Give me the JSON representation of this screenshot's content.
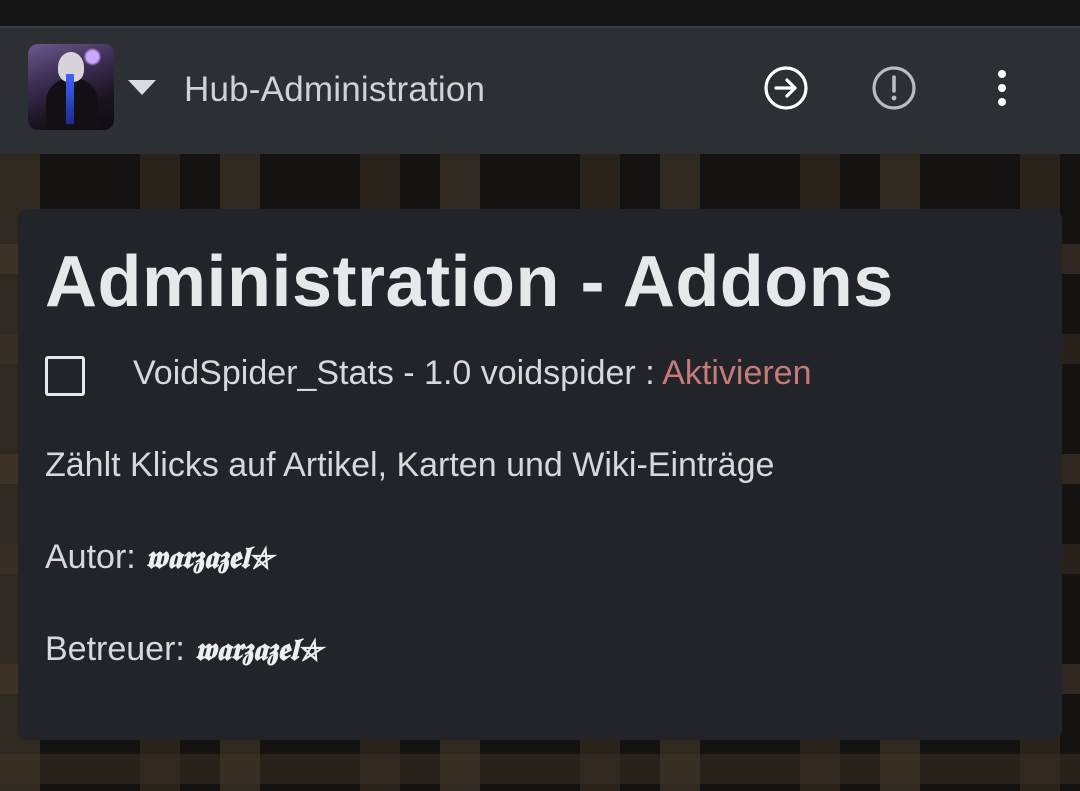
{
  "header": {
    "title": "Hub-Administration",
    "icons": {
      "navigate": "arrow-right-circle-icon",
      "alert": "exclamation-circle-icon",
      "menu": "more-vertical-icon"
    }
  },
  "card": {
    "title": "Administration - Addons",
    "addon": {
      "name_version_author": "VoidSpider_Stats - 1.0 voidspider : ",
      "activate_label": "Aktivieren",
      "checked": false
    },
    "description": "Zählt Klicks auf Artikel, Karten und Wiki-Einträge",
    "author_label": "Autor: ",
    "author_name": "𝖜𝖆𝖗𝖟𝖆𝖟𝖊𝖑⛤",
    "maintainer_label": "Betreuer: ",
    "maintainer_name": "𝖜𝖆𝖗𝖟𝖆𝖟𝖊𝖑⛤"
  },
  "colors": {
    "topbar": "#2c3035",
    "card": "#222429",
    "link": "#c67a7a",
    "text": "#d6d9dc"
  }
}
